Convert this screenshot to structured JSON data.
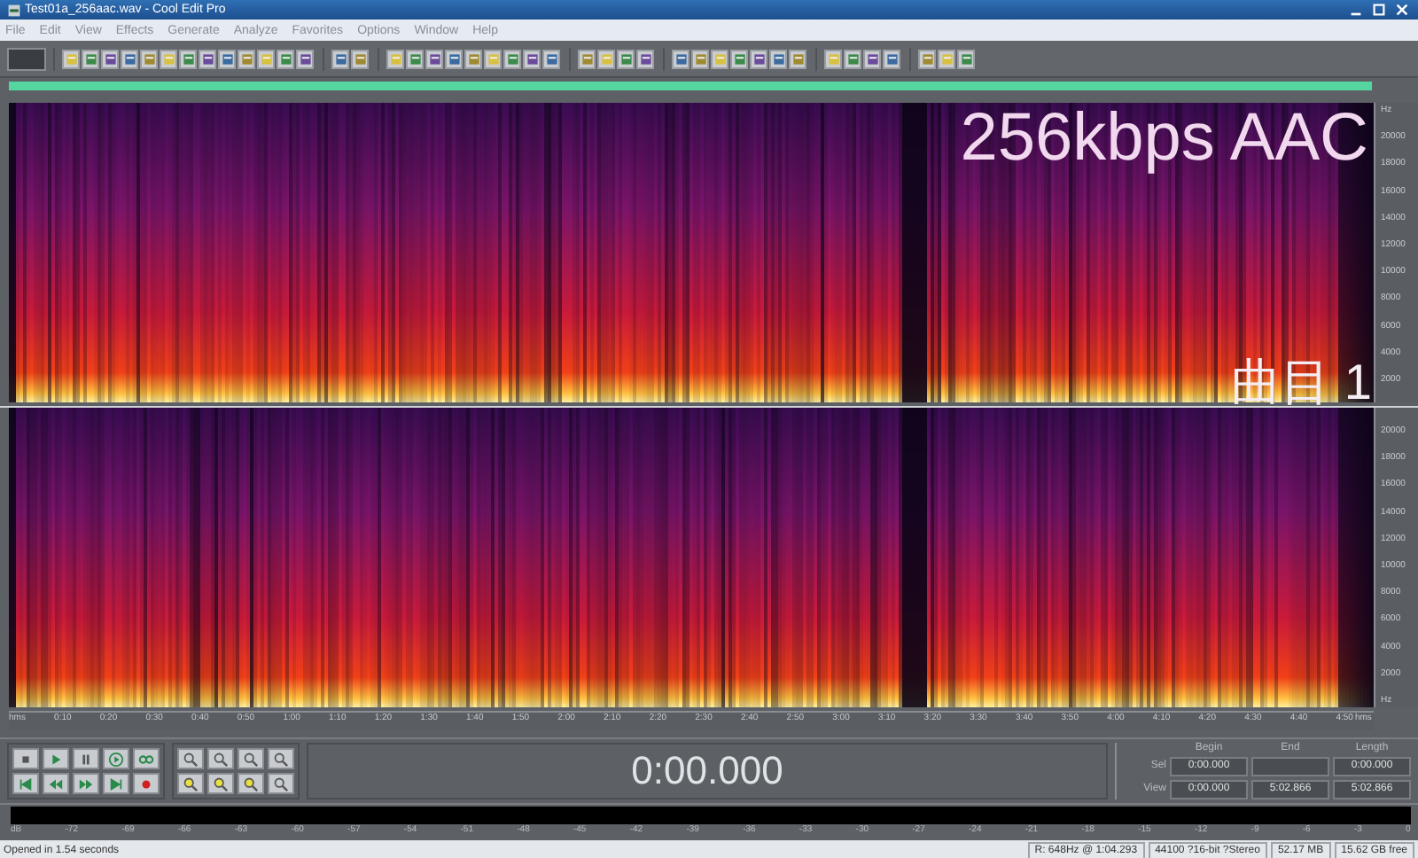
{
  "window": {
    "title": "Test01a_256aac.wav - Cool Edit Pro"
  },
  "menu": [
    "File",
    "Edit",
    "View",
    "Effects",
    "Generate",
    "Analyze",
    "Favorites",
    "Options",
    "Window",
    "Help"
  ],
  "overlay": {
    "caption": "256kbps AAC",
    "track": "曲目 1"
  },
  "frequency_axis": [
    {
      "labels": [
        "Hz",
        "20000",
        "18000",
        "16000",
        "14000",
        "12000",
        "10000",
        "8000",
        "6000",
        "4000",
        "2000"
      ]
    },
    {
      "labels": [
        "20000",
        "18000",
        "16000",
        "14000",
        "12000",
        "10000",
        "8000",
        "6000",
        "4000",
        "2000",
        "Hz"
      ]
    }
  ],
  "time_ruler": {
    "labels": [
      "hms",
      "0:10",
      "0:20",
      "0:30",
      "0:40",
      "0:50",
      "1:00",
      "1:10",
      "1:20",
      "1:30",
      "1:40",
      "1:50",
      "2:00",
      "2:10",
      "2:20",
      "2:30",
      "2:40",
      "2:50",
      "3:00",
      "3:10",
      "3:20",
      "3:30",
      "3:40",
      "3:50",
      "4:00",
      "4:10",
      "4:20",
      "4:30",
      "4:40",
      "4:50",
      "hms"
    ]
  },
  "time_display": "0:00.000",
  "selection": {
    "columns": [
      "Begin",
      "End",
      "Length"
    ],
    "rows": [
      {
        "label": "Sel",
        "begin": "0:00.000",
        "length": "0:00.000"
      },
      {
        "label": "View",
        "begin": "0:00.000",
        "end": "5:02.866",
        "length": "5:02.866"
      }
    ]
  },
  "level_meter": {
    "labels": [
      "dB",
      "-72",
      "-69",
      "-66",
      "-63",
      "-60",
      "-57",
      "-54",
      "-51",
      "-48",
      "-45",
      "-42",
      "-39",
      "-36",
      "-33",
      "-30",
      "-27",
      "-24",
      "-21",
      "-18",
      "-15",
      "-12",
      "-9",
      "-6",
      "-3",
      "0"
    ]
  },
  "status_bar": [
    "Opened in 1.54 seconds",
    "R: 648Hz @  1:04.293",
    "44100 ?16-bit ?Stereo",
    "52.17 MB",
    "15.62 GB free"
  ]
}
